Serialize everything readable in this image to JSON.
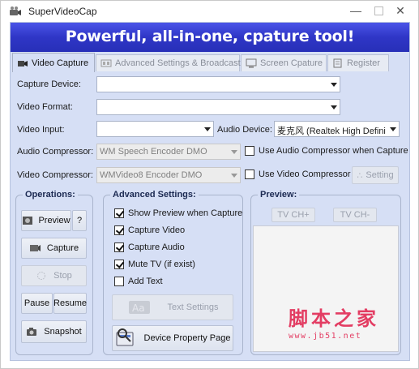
{
  "window": {
    "title": "SuperVideoCap"
  },
  "banner": {
    "text": "Powerful, all-in-one, cpature tool!"
  },
  "tabs": [
    {
      "label": "Video Capture",
      "active": true,
      "icon": "video-icon"
    },
    {
      "label": "Advanced Settings & Broadcast",
      "active": false,
      "icon": "film-icon"
    },
    {
      "label": "Screen Cpature",
      "active": false,
      "icon": "monitor-icon"
    },
    {
      "label": "Register",
      "active": false,
      "icon": "register-icon"
    }
  ],
  "form": {
    "capture_device": {
      "label": "Capture Device:",
      "value": ""
    },
    "video_format": {
      "label": "Video Format:",
      "value": ""
    },
    "video_input": {
      "label": "Video Input:",
      "value": ""
    },
    "audio_device": {
      "label": "Audio Device:",
      "value": "麦克风 (Realtek High Defini"
    },
    "audio_compressor": {
      "label": "Audio Compressor:",
      "value": "WM Speech Encoder DMO"
    },
    "use_audio_compressor": {
      "label": "Use Audio Compressor when Capture",
      "checked": false
    },
    "video_compressor": {
      "label": "Video Compressor:",
      "value": "WMVideo8 Encoder DMO"
    },
    "use_video_compressor": {
      "label": "Use Video Compressor",
      "checked": false
    },
    "setting_button": "Setting"
  },
  "operations": {
    "title": "Operations:",
    "preview": "Preview",
    "help": "?",
    "capture": "Capture",
    "stop": "Stop",
    "pause": "Pause",
    "resume": "Resume",
    "snapshot": "Snapshot"
  },
  "advanced": {
    "title": "Advanced Settings:",
    "options": [
      {
        "label": "Show Preview when Capture",
        "checked": true
      },
      {
        "label": "Capture Video",
        "checked": true
      },
      {
        "label": "Capture Audio",
        "checked": true
      },
      {
        "label": "Mute TV (if exist)",
        "checked": true
      },
      {
        "label": "Add Text",
        "checked": false
      }
    ],
    "text_settings": "Text Settings",
    "device_property": "Device Property Page"
  },
  "preview": {
    "title": "Preview:",
    "tv_up": "TV CH+",
    "tv_down": "TV CH-"
  },
  "watermark": {
    "title": "脚本之家",
    "url": "www.jb51.net"
  },
  "colors": {
    "banner": "#3038c8",
    "client": "#d6dff5",
    "watermark": "#e33d63"
  }
}
